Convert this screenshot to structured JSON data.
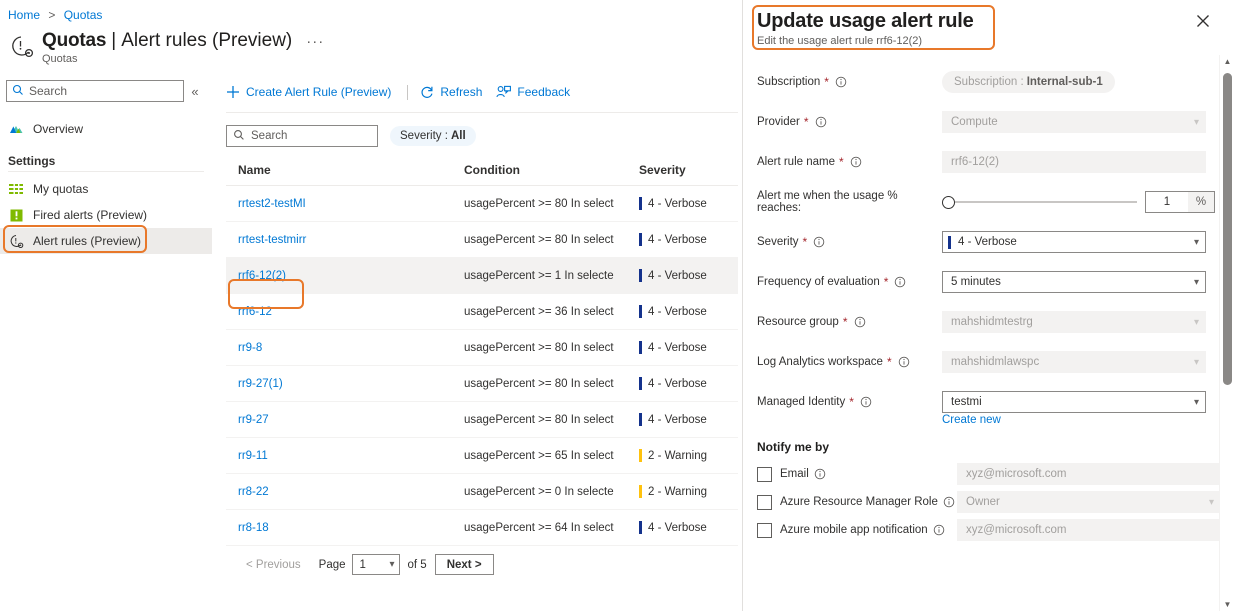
{
  "breadcrumb": {
    "items": [
      "Home",
      "Quotas"
    ],
    "separator": ">"
  },
  "page": {
    "title_main": "Quotas",
    "title_sep": "|",
    "title_sub": "Alert rules (Preview)",
    "ellipsis": "···",
    "subtitle": "Quotas",
    "icon": "quota-gauge-icon"
  },
  "leftnav": {
    "search_placeholder": "Search",
    "collapse_icon": "double-chevron-left-icon",
    "overview": {
      "label": "Overview",
      "icon": "cloud-icon"
    },
    "group_label": "Settings",
    "items": [
      {
        "label": "My quotas",
        "icon": "list-icon",
        "selected": false
      },
      {
        "label": "Fired alerts (Preview)",
        "icon": "alert-bar-icon",
        "selected": false
      },
      {
        "label": "Alert rules (Preview)",
        "icon": "alert-clock-icon",
        "selected": true
      }
    ]
  },
  "toolbar": {
    "create_label": "Create Alert Rule (Preview)",
    "create_icon": "plus-icon",
    "refresh_label": "Refresh",
    "refresh_icon": "refresh-icon",
    "feedback_label": "Feedback",
    "feedback_icon": "feedback-person-icon"
  },
  "filters": {
    "search_placeholder": "Search",
    "search_icon": "search-icon",
    "severity_pill_prefix": "Severity : ",
    "severity_pill_value": "All"
  },
  "table": {
    "columns": [
      "Name",
      "Condition",
      "Severity"
    ],
    "rows": [
      {
        "name": "rrtest2-testMI",
        "condition": "usagePercent >= 80 In select",
        "severity": "4 - Verbose",
        "sev_color": "#14328c",
        "selected": false
      },
      {
        "name": "rrtest-testmirr",
        "condition": "usagePercent >= 80 In select",
        "severity": "4 - Verbose",
        "sev_color": "#14328c",
        "selected": false
      },
      {
        "name": "rrf6-12(2)",
        "condition": "usagePercent >= 1 In selecte",
        "severity": "4 - Verbose",
        "sev_color": "#14328c",
        "selected": true
      },
      {
        "name": "rrf6-12",
        "condition": "usagePercent >= 36 In select",
        "severity": "4 - Verbose",
        "sev_color": "#14328c",
        "selected": false
      },
      {
        "name": "rr9-8",
        "condition": "usagePercent >= 80 In select",
        "severity": "4 - Verbose",
        "sev_color": "#14328c",
        "selected": false
      },
      {
        "name": "rr9-27(1)",
        "condition": "usagePercent >= 80 In select",
        "severity": "4 - Verbose",
        "sev_color": "#14328c",
        "selected": false
      },
      {
        "name": "rr9-27",
        "condition": "usagePercent >= 80 In select",
        "severity": "4 - Verbose",
        "sev_color": "#14328c",
        "selected": false
      },
      {
        "name": "rr9-11",
        "condition": "usagePercent >= 65 In select",
        "severity": "2 - Warning",
        "sev_color": "#ffc20e",
        "selected": false
      },
      {
        "name": "rr8-22",
        "condition": "usagePercent >= 0 In selecte",
        "severity": "2 - Warning",
        "sev_color": "#ffc20e",
        "selected": false
      },
      {
        "name": "rr8-18",
        "condition": "usagePercent >= 64 In select",
        "severity": "4 - Verbose",
        "sev_color": "#14328c",
        "selected": false
      }
    ]
  },
  "pagination": {
    "previous_label": "< Previous",
    "page_label": "Page",
    "page_value": "1",
    "of_label": "of 5",
    "next_label": "Next >"
  },
  "panel": {
    "title": "Update usage alert rule",
    "subtitle": "Edit the usage alert rule rrf6-12(2)",
    "close_icon": "close-icon",
    "fields": {
      "subscription": {
        "label": "Subscription",
        "required": "*",
        "info": "info-icon",
        "chip_prefix": "Subscription : ",
        "chip_value": "Internal-sub-1"
      },
      "provider": {
        "label": "Provider",
        "required": "*",
        "info": "info-icon",
        "value": "Compute",
        "chevron": "chevron-down-icon"
      },
      "alert_rule_name": {
        "label": "Alert rule name",
        "required": "*",
        "info": "info-icon",
        "value": "rrf6-12(2)"
      },
      "usage_threshold": {
        "label": "Alert me when the usage % reaches:",
        "value": "1",
        "unit": "%",
        "slider_position_pct": 0
      },
      "severity": {
        "label": "Severity",
        "required": "*",
        "info": "info-icon",
        "value": "4 - Verbose",
        "swatch_color": "#14328c",
        "chevron": "chevron-down-icon"
      },
      "frequency": {
        "label": "Frequency of evaluation",
        "required": "*",
        "info": "info-icon",
        "value": "5 minutes",
        "chevron": "chevron-down-icon"
      },
      "resource_group": {
        "label": "Resource group",
        "required": "*",
        "info": "info-icon",
        "value": "mahshidmtestrg",
        "chevron": "chevron-down-icon"
      },
      "log_analytics": {
        "label": "Log Analytics workspace",
        "required": "*",
        "info": "info-icon",
        "value": "mahshidmlawspc",
        "chevron": "chevron-down-icon"
      },
      "managed_identity": {
        "label": "Managed Identity",
        "required": "*",
        "info": "info-icon",
        "value": "testmi",
        "chevron": "chevron-down-icon",
        "create_new_label": "Create new"
      }
    },
    "notify": {
      "section_label": "Notify me by",
      "rows": [
        {
          "label": "Email",
          "info": "info-icon",
          "checked": false,
          "value": "xyz@microsoft.com",
          "type": "text"
        },
        {
          "label": "Azure Resource Manager Role",
          "info": "info-icon",
          "checked": false,
          "value": "Owner",
          "type": "select"
        },
        {
          "label": "Azure mobile app notification",
          "info": "info-icon",
          "checked": false,
          "value": "xyz@microsoft.com",
          "type": "text"
        }
      ]
    },
    "scrollbar": {
      "up_icon": "scroll-up-icon",
      "down_icon": "scroll-down-icon"
    }
  },
  "highlights": {
    "accent_color": "#e8782a",
    "boxes": [
      "sidebar-alert-rules",
      "table-row-rrf6-12-2",
      "panel-title"
    ]
  }
}
